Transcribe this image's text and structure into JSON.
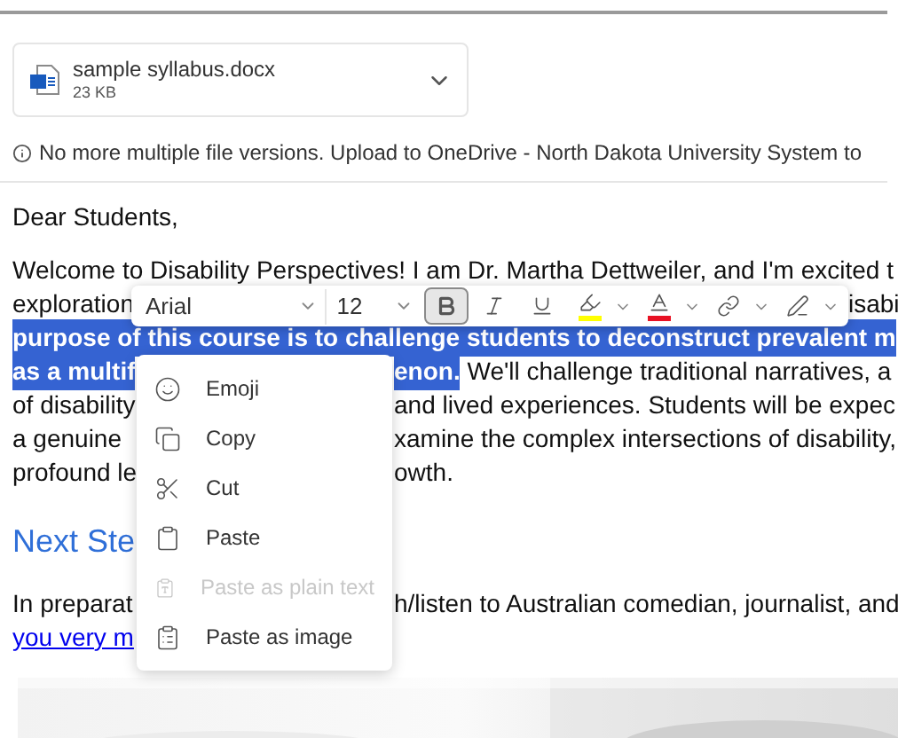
{
  "attachment": {
    "name": "sample syllabus.docx",
    "size": "23 KB"
  },
  "notice": "No more multiple file versions. Upload to OneDrive - North Dakota University System to",
  "greeting": "Dear Students,",
  "paragraph_lines": [
    {
      "left": [
        {
          "text": "Welcome to Disability Perspectives! I am Dr. Martha Dettweiler, and I'm excited t",
          "highlighted": false
        }
      ]
    },
    {
      "left": [
        {
          "text": "exploration",
          "highlighted": false
        }
      ],
      "right": [
        {
          "text": "isabi",
          "highlighted": false
        }
      ]
    },
    {
      "left": [
        {
          "text": "purpose of this course is to challenge students to deconstruct prevalent m",
          "highlighted": true
        }
      ]
    },
    {
      "left": [
        {
          "text": "as a multif",
          "highlighted": true
        }
      ],
      "right": [
        {
          "text": "enon.",
          "highlighted": true
        },
        {
          "text": " We'll challenge traditional narratives, a",
          "highlighted": false
        }
      ]
    },
    {
      "left": [
        {
          "text": "of disability",
          "highlighted": false
        }
      ],
      "right": [
        {
          "text": "and lived experiences. Students will be expec",
          "highlighted": false
        }
      ]
    },
    {
      "left": [
        {
          "text": "a genuine",
          "highlighted": false
        }
      ],
      "right": [
        {
          "text": "xamine the complex intersections of disability,",
          "highlighted": false
        }
      ]
    },
    {
      "left": [
        {
          "text": "profound le",
          "highlighted": false
        }
      ],
      "right": [
        {
          "text": "owth.",
          "highlighted": false
        }
      ]
    }
  ],
  "heading": "Next Ste",
  "second_paragraph": [
    {
      "left": [
        {
          "text": "In preparat",
          "highlighted": false
        }
      ],
      "right": [
        {
          "text": "h/listen to Australian comedian, journalist, and",
          "highlighted": false
        }
      ]
    }
  ],
  "link": "you very m",
  "toolbar": {
    "font": "Arial",
    "size": "12",
    "buttons": [
      {
        "kind": "bold",
        "selected": true,
        "dropdown": false
      },
      {
        "kind": "italic",
        "selected": false,
        "dropdown": false
      },
      {
        "kind": "underline",
        "selected": false,
        "dropdown": false
      },
      {
        "kind": "highlight",
        "selected": false,
        "dropdown": true,
        "color": "#ffff00"
      },
      {
        "kind": "font-color",
        "selected": false,
        "dropdown": true,
        "color": "#e81123"
      },
      {
        "kind": "link",
        "selected": false,
        "dropdown": true
      },
      {
        "kind": "styles",
        "selected": false,
        "dropdown": true
      }
    ]
  },
  "context_menu": [
    {
      "kind": "emoji",
      "label": "Emoji",
      "disabled": false
    },
    {
      "kind": "copy",
      "label": "Copy",
      "disabled": false
    },
    {
      "kind": "cut",
      "label": "Cut",
      "disabled": false
    },
    {
      "kind": "paste",
      "label": "Paste",
      "disabled": false
    },
    {
      "kind": "paste-text",
      "label": "Paste as plain text",
      "disabled": true
    },
    {
      "kind": "paste-image",
      "label": "Paste as image",
      "disabled": false
    }
  ]
}
